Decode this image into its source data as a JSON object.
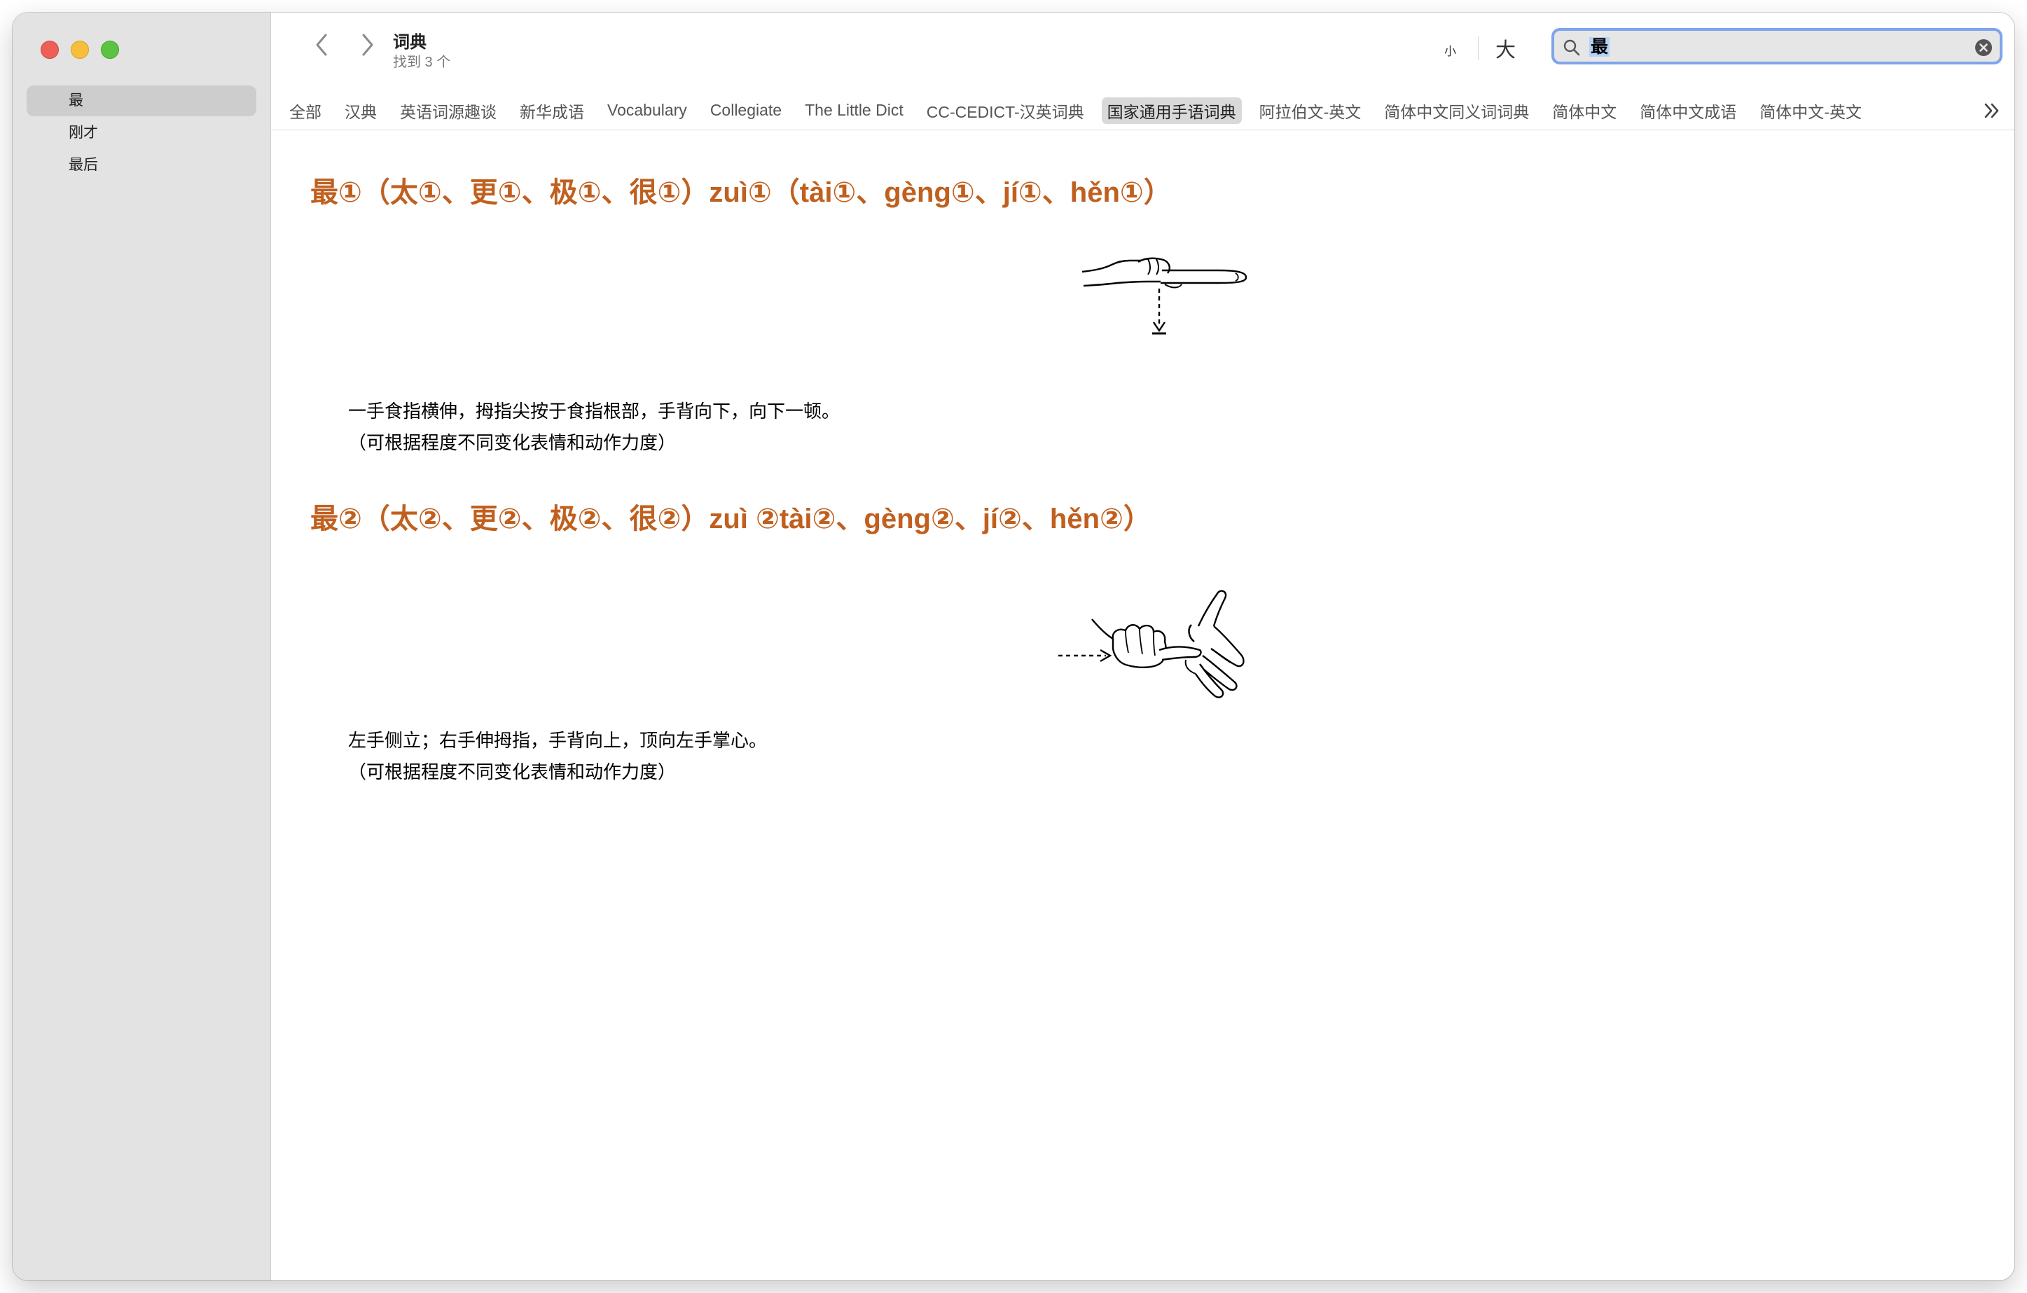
{
  "sidebar": {
    "history": [
      {
        "label": "最",
        "selected": true
      },
      {
        "label": "刚才",
        "selected": false
      },
      {
        "label": "最后",
        "selected": false
      }
    ]
  },
  "toolbar": {
    "title": "词典",
    "subtitle": "找到 3 个",
    "font_small": "小",
    "font_large": "大"
  },
  "search": {
    "value": "最"
  },
  "tabs": [
    {
      "label": "全部"
    },
    {
      "label": "汉典"
    },
    {
      "label": "英语词源趣谈"
    },
    {
      "label": "新华成语"
    },
    {
      "label": "Vocabulary"
    },
    {
      "label": "Collegiate"
    },
    {
      "label": "The Little Dict"
    },
    {
      "label": "CC-CEDICT-汉英词典"
    },
    {
      "label": "国家通用手语词典",
      "active": true
    },
    {
      "label": "阿拉伯文-英文"
    },
    {
      "label": "简体中文同义词词典"
    },
    {
      "label": "简体中文"
    },
    {
      "label": "简体中文成语"
    },
    {
      "label": "简体中文-英文"
    }
  ],
  "entries": [
    {
      "title": "最①（太①、更①、极①、很①）zuì①（tài①、gèng①、jí①、hěn①）",
      "lines": [
        "一手食指横伸，拇指尖按于食指根部，手背向下，向下一顿。",
        "（可根据程度不同变化表情和动作力度）"
      ]
    },
    {
      "title": "最②（太②、更②、极②、很②）zuì ②tài②、gèng②、jí②、hěn②）",
      "lines": [
        "左手侧立；右手伸拇指，手背向上，顶向左手掌心。",
        "（可根据程度不同变化表情和动作力度）"
      ]
    }
  ],
  "colors": {
    "entry_title": "#c0601f",
    "search_border": "#7ea4ec",
    "sidebar_bg": "#e3e3e3"
  }
}
